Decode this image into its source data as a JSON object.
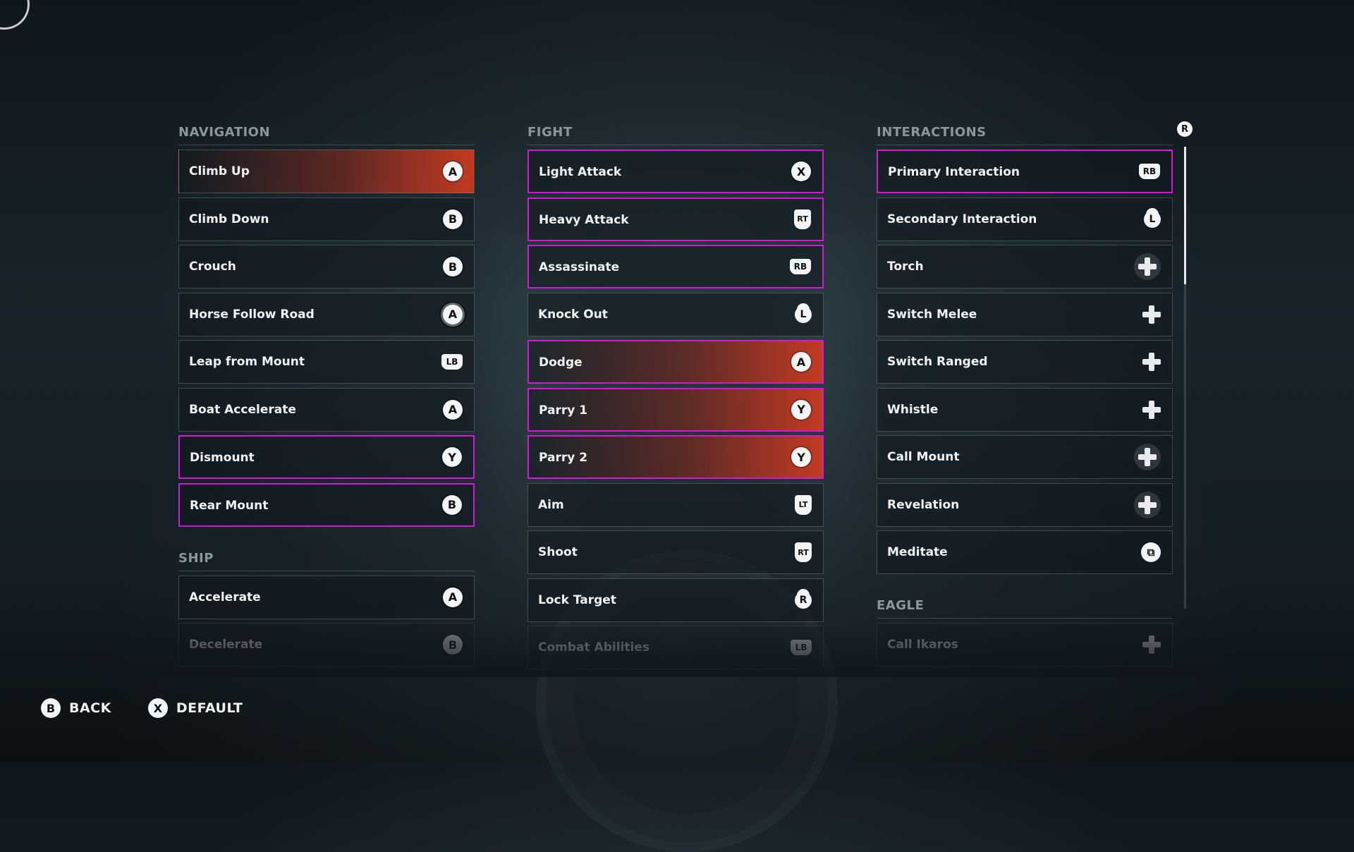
{
  "sections": {
    "navigation": {
      "title": "NAVIGATION",
      "items": [
        {
          "label": "Climb Up",
          "button": "A"
        },
        {
          "label": "Climb Down",
          "button": "B"
        },
        {
          "label": "Crouch",
          "button": "B"
        },
        {
          "label": "Horse Follow Road",
          "button": "A"
        },
        {
          "label": "Leap from Mount",
          "button": "LB"
        },
        {
          "label": "Boat Accelerate",
          "button": "A"
        },
        {
          "label": "Dismount",
          "button": "Y"
        },
        {
          "label": "Rear Mount",
          "button": "B"
        }
      ]
    },
    "ship": {
      "title": "SHIP",
      "items": [
        {
          "label": "Accelerate",
          "button": "A"
        },
        {
          "label": "Decelerate",
          "button": "B"
        }
      ]
    },
    "fight": {
      "title": "FIGHT",
      "items": [
        {
          "label": "Light Attack",
          "button": "X"
        },
        {
          "label": "Heavy Attack",
          "button": "RT"
        },
        {
          "label": "Assassinate",
          "button": "RB"
        },
        {
          "label": "Knock Out",
          "button": "L"
        },
        {
          "label": "Dodge",
          "button": "A"
        },
        {
          "label": "Parry 1",
          "button": "Y"
        },
        {
          "label": "Parry 2",
          "button": "Y"
        },
        {
          "label": "Aim",
          "button": "LT"
        },
        {
          "label": "Shoot",
          "button": "RT"
        },
        {
          "label": "Lock Target",
          "button": "R"
        },
        {
          "label": "Combat Abilities",
          "button": "LB"
        }
      ]
    },
    "interactions": {
      "title": "INTERACTIONS",
      "items": [
        {
          "label": "Primary Interaction",
          "button": "RB"
        },
        {
          "label": "Secondary Interaction",
          "button": "L"
        },
        {
          "label": "Torch",
          "button": "dpad-right-icon"
        },
        {
          "label": "Switch Melee",
          "button": "dpad-right-icon"
        },
        {
          "label": "Switch Ranged",
          "button": "dpad-right-icon"
        },
        {
          "label": "Whistle",
          "button": "dpad-down-icon"
        },
        {
          "label": "Call Mount",
          "button": "dpad-down-icon"
        },
        {
          "label": "Revelation",
          "button": "dpad-up-icon"
        },
        {
          "label": "Meditate",
          "button": "view-icon"
        }
      ]
    },
    "eagle": {
      "title": "EAGLE",
      "items": [
        {
          "label": "Call Ikaros",
          "button": "dpad-up-icon"
        }
      ]
    }
  },
  "scroll_icon": "R",
  "footer": {
    "back_button": "B",
    "back_label": "BACK",
    "default_button": "X",
    "default_label": "DEFAULT"
  },
  "colors": {
    "highlight": "#c23a22",
    "conflict_border": "#d21bd0"
  }
}
